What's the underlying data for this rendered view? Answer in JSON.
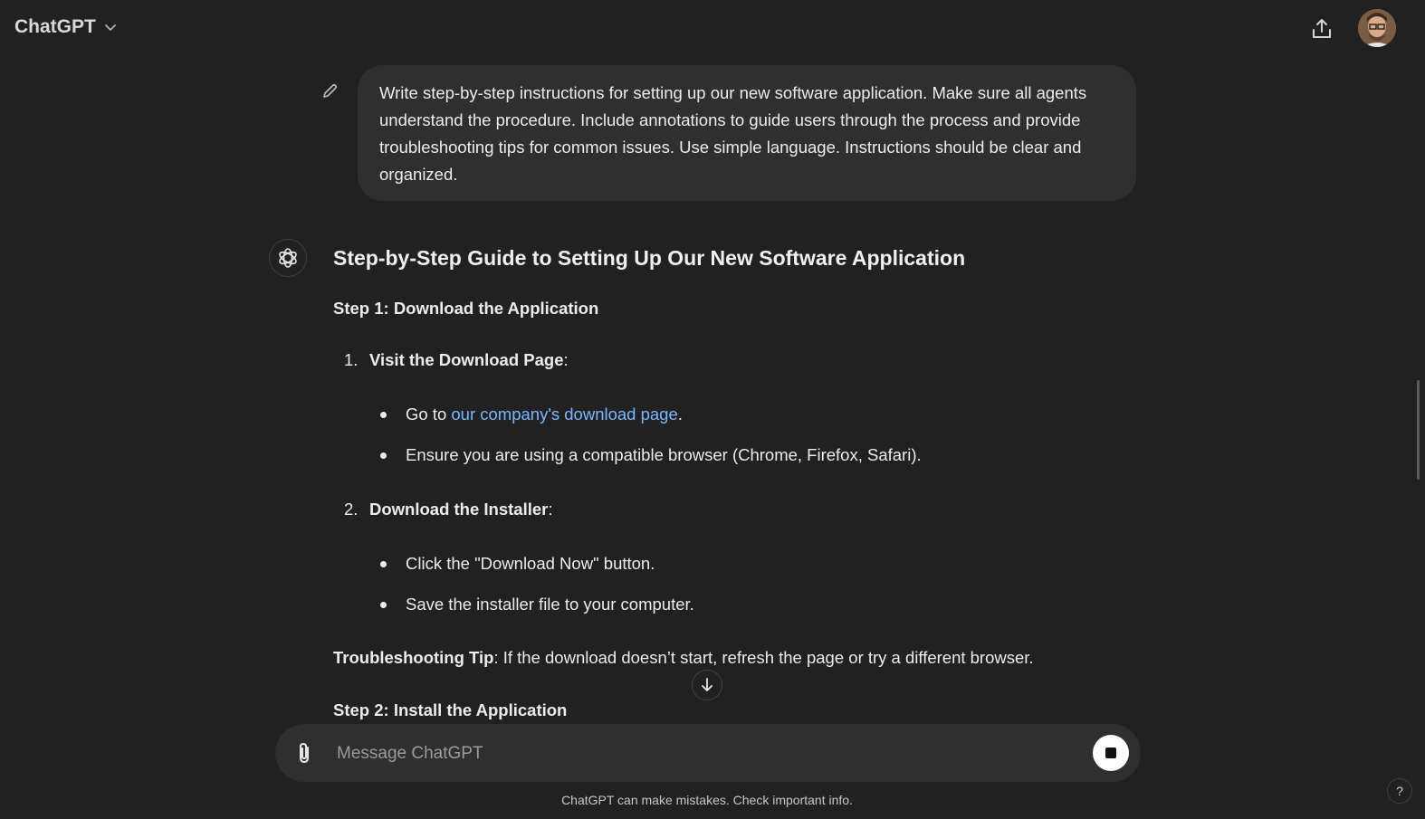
{
  "header": {
    "model_name": "ChatGPT",
    "share_icon": "share-upload-icon",
    "avatar_icon": "user-avatar"
  },
  "user_message": {
    "text": "Write step-by-step instructions for setting up our new software application. Make sure all agents understand the procedure. Include annotations to guide users through the process and provide troubleshooting tips for common issues. Use simple language. Instructions should be clear and organized."
  },
  "assistant": {
    "title": "Step-by-Step Guide to Setting Up Our New Software Application",
    "step1_heading": "Step 1: Download the Application",
    "items": [
      {
        "number": "1.",
        "label": "Visit the Download Page",
        "bullets": [
          {
            "prefix": "Go to ",
            "link": "our company's download page",
            "suffix": "."
          },
          {
            "text": "Ensure you are using a compatible browser (Chrome, Firefox, Safari)."
          }
        ]
      },
      {
        "number": "2.",
        "label": "Download the Installer",
        "bullets": [
          {
            "text": "Click the \"Download Now\" button."
          },
          {
            "text": "Save the installer file to your computer."
          }
        ]
      }
    ],
    "tip_label": "Troubleshooting Tip",
    "tip_text": ": If the download doesn’t start, refresh the page or try a different browser.",
    "step2_heading": "Step 2: Install the Application"
  },
  "composer": {
    "placeholder": "Message ChatGPT"
  },
  "footer": {
    "disclaimer": "ChatGPT can make mistakes. Check important info.",
    "help": "?"
  }
}
